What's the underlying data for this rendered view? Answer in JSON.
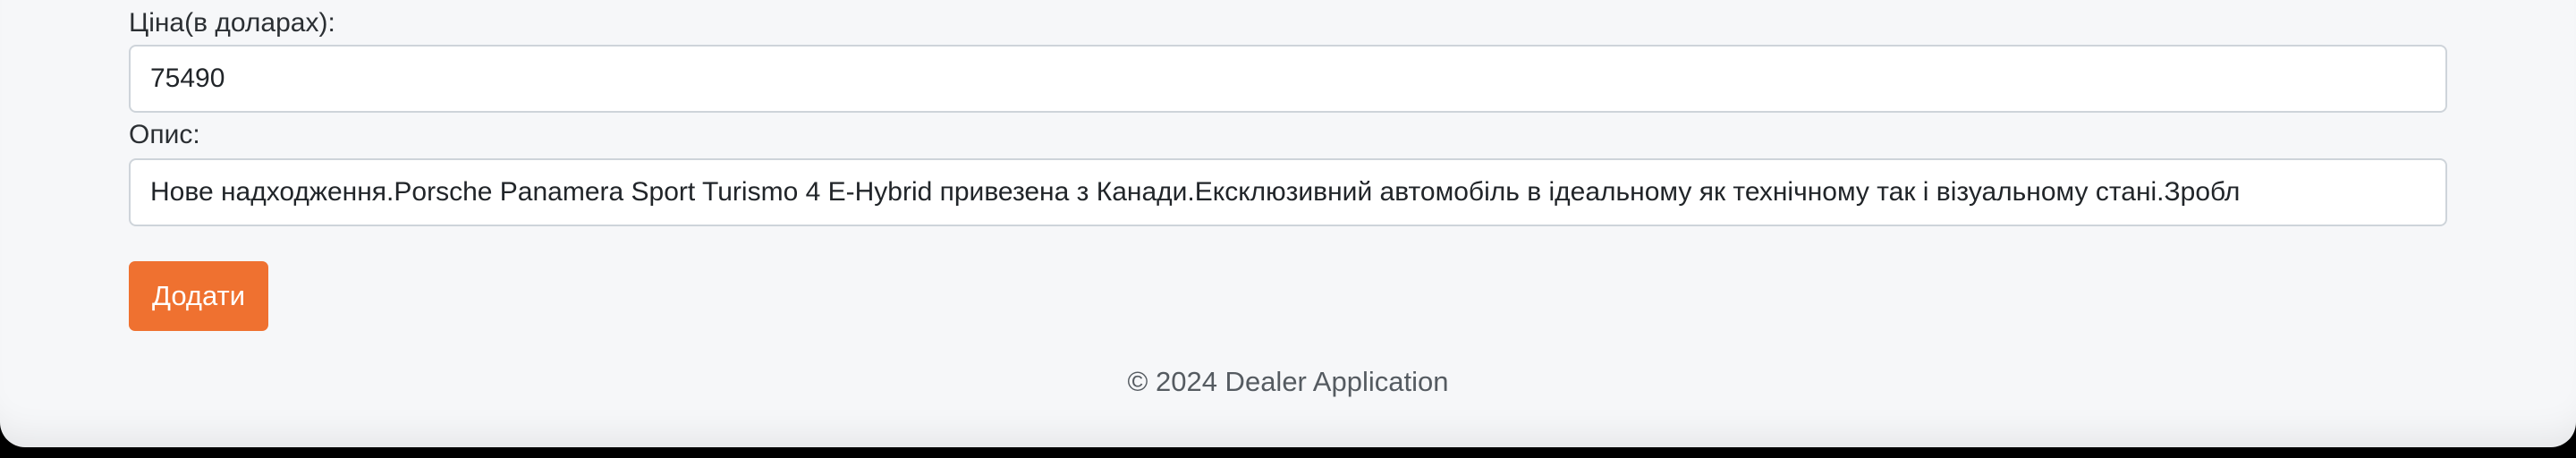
{
  "form": {
    "price_label": "Ціна(в доларах):",
    "price_value": "75490",
    "description_label": "Опис:",
    "description_value": "Нове надходження.Porsche Panamera Sport Turismo 4 E-Hybrid привезена з Канади.Ексклюзивний автомобіль в ідеальному як технічному так і візуальному стані.Зробл",
    "submit_label": "Додати"
  },
  "footer": {
    "text": "© 2024 Dealer Application"
  },
  "colors": {
    "accent": "#ef7130",
    "background": "#f6f7f9"
  }
}
